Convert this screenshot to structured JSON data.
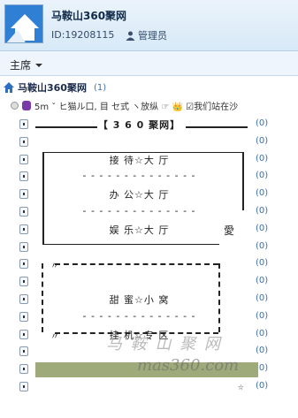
{
  "header": {
    "room_title": "马鞍山360聚网",
    "room_id": "ID:19208115",
    "role": "管理员"
  },
  "menu": {
    "main_label": "主席"
  },
  "channel": {
    "name": "马鞍山360聚网",
    "count": "(1)"
  },
  "toolbar": {
    "text": "5m ˇ ヒ猫ル口, 目 セ式 ヽ放纵 ☞ 👑 ☑我们站在沙"
  },
  "rows": [
    {
      "text": "【 3 6 0 聚网】",
      "count": "(0)"
    },
    {
      "text": "",
      "count": "(0)"
    },
    {
      "text": "接 待☆大 厅",
      "count": "(0)"
    },
    {
      "text": "- - - - - - - - - - - - - -",
      "count": "(0)"
    },
    {
      "text": "办 公☆大 厅",
      "count": "(0)"
    },
    {
      "text": "- - - - - - - - - - - - - -",
      "count": "(0)"
    },
    {
      "text": "娱 乐☆大 厅",
      "count": "(0)"
    },
    {
      "text": "",
      "count": "(0)"
    },
    {
      "text": "",
      "count": "(0)"
    },
    {
      "text": "",
      "count": "(0)"
    },
    {
      "text": "甜 蜜☆小 窝",
      "count": "(0)"
    },
    {
      "text": "- - - - - - - - - - - - - -",
      "count": "(0)"
    },
    {
      "text": "挂 机☆专 区",
      "count": "(0)"
    },
    {
      "text": "",
      "count": "(0)"
    },
    {
      "text": "",
      "count": "(0)"
    },
    {
      "text": "",
      "count": "(0)"
    }
  ],
  "decor": {
    "love": "愛",
    "star": "☆",
    "slashes": "〃"
  },
  "watermark": {
    "line1": "马 鞍 山 聚 网",
    "line2": "mas360.com"
  }
}
